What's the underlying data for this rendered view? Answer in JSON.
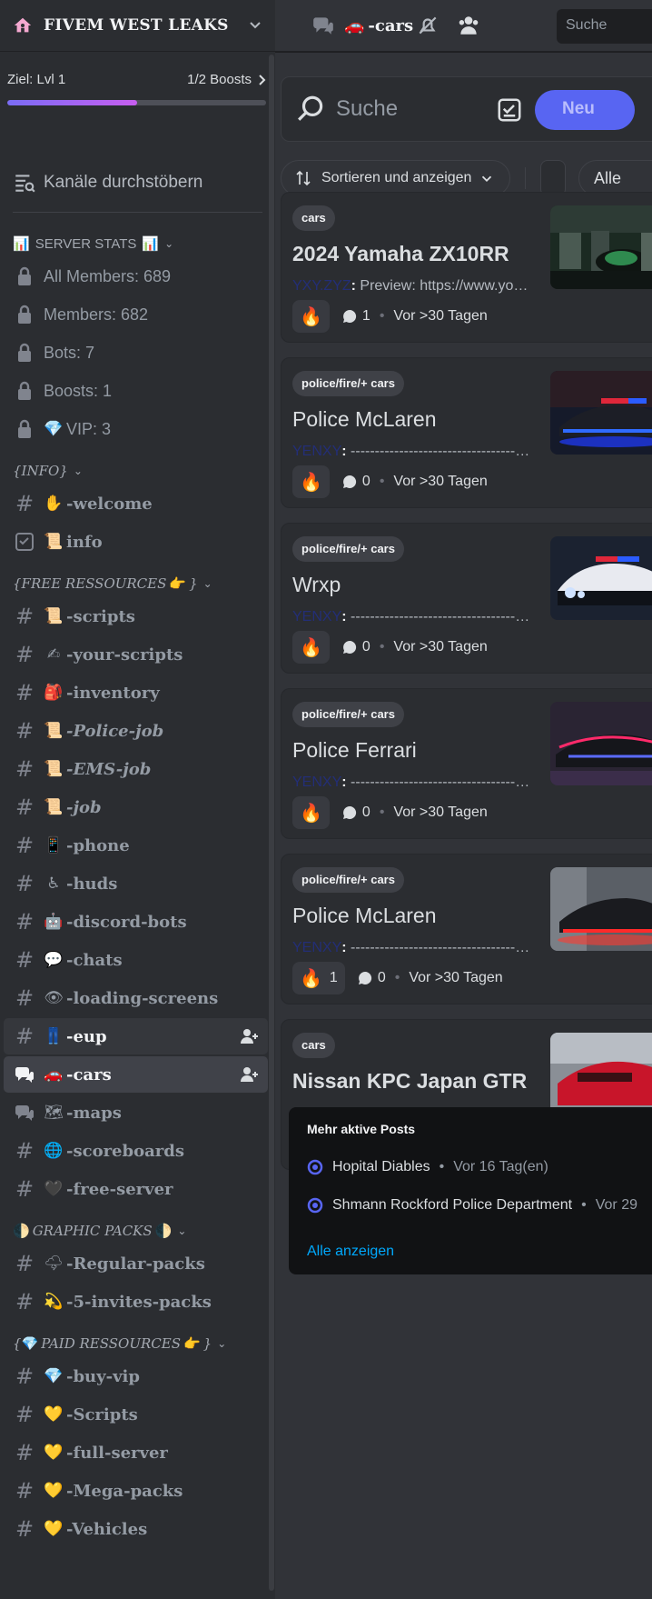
{
  "server": {
    "name": "FIVEM WEST LEAKS"
  },
  "boost": {
    "goal": "Ziel: Lvl 1",
    "progress": "1/2 Boosts",
    "fill_fraction": 0.5
  },
  "browse_label": "Kanäle durchstöbern",
  "categories": {
    "stats": "SERVER STATS",
    "stats_emoji": "📊",
    "info": "{INFO}",
    "free": "{FREE RESSOURCES",
    "free_tail": "}",
    "free_emoji": "👉",
    "graphic": "GRAPHIC PACKS",
    "graphic_emoji": "🌓",
    "paid": "{",
    "paid_emoji": "💎",
    "paid_name": "PAID RESSOURCES",
    "paid_tail": "}",
    "paid_emoji2": "👉"
  },
  "stats_channels": [
    {
      "label": "All Members: 689"
    },
    {
      "label": "Members: 682"
    },
    {
      "label": "Bots: 7"
    },
    {
      "label": "Boosts: 1"
    },
    {
      "emoji": "💎",
      "label": "VIP: 3"
    }
  ],
  "info_channels": [
    {
      "emoji": "✋",
      "label": "-welcome"
    },
    {
      "emoji": "📜",
      "label": "info"
    }
  ],
  "free_channels": [
    {
      "emoji": "📜",
      "label": "-scripts"
    },
    {
      "emoji": "✍",
      "label": "-your-scripts"
    },
    {
      "emoji": "🎒",
      "label": "-inventory"
    },
    {
      "emoji": "📜",
      "label": "-Police-job"
    },
    {
      "emoji": "📜",
      "label": "-EMS-job"
    },
    {
      "emoji": "📜",
      "label": "-job"
    },
    {
      "emoji": "📱",
      "label": "-phone"
    },
    {
      "emoji": "♿",
      "label": "-huds"
    },
    {
      "emoji": "🤖",
      "label": "-discord-bots"
    },
    {
      "emoji": "💬",
      "label": "-chats"
    },
    {
      "emoji": "👁",
      "label": "-loading-screens"
    },
    {
      "emoji": "👖",
      "label": "-eup"
    },
    {
      "emoji": "🚗",
      "label": "-cars"
    },
    {
      "emoji": "🗺",
      "label": "-maps"
    },
    {
      "emoji": "🌐",
      "label": "-scoreboards"
    },
    {
      "emoji": "🖤",
      "label": "-free-server"
    }
  ],
  "graphic_channels": [
    {
      "emoji": "🌩",
      "label": "-Regular-packs"
    },
    {
      "emoji": "💫",
      "label": "-5-invites-packs"
    }
  ],
  "paid_channels": [
    {
      "emoji": "💎",
      "label": "-buy-vip"
    },
    {
      "emoji": "💛",
      "label": "-Scripts"
    },
    {
      "emoji": "💛",
      "label": "-full-server"
    },
    {
      "emoji": "💛",
      "label": "-Mega-packs"
    },
    {
      "emoji": "💛",
      "label": "-Vehicles"
    }
  ],
  "header": {
    "channel_emoji": "🚗",
    "channel_name": "-cars",
    "search_placeholder": "Suche"
  },
  "forum": {
    "search_placeholder": "Suche",
    "new_button": "Neu",
    "sort_label": "Sortieren und anzeigen",
    "all_label": "Alle"
  },
  "posts": [
    {
      "tag": "cars",
      "title": "2024 Yamaha ZX10RR",
      "author": "YXY.ZYZ",
      "preview": "Preview: https://www.youtube.com/",
      "reaction": "🔥",
      "reaction_count": "",
      "comments": "1",
      "age": "Vor >30 Tagen"
    },
    {
      "tag": "police/fire/+ cars",
      "title": "Police McLaren",
      "author": "YENXY",
      "preview": "--------------------------------------",
      "reaction": "🔥",
      "reaction_count": "",
      "comments": "0",
      "age": "Vor >30 Tagen"
    },
    {
      "tag": "police/fire/+ cars",
      "title": "Wrxp",
      "author": "YENXY",
      "preview": "--------------------------------------",
      "reaction": "🔥",
      "reaction_count": "",
      "comments": "0",
      "age": "Vor >30 Tagen"
    },
    {
      "tag": "police/fire/+ cars",
      "title": "Police Ferrari",
      "author": "YENXY",
      "preview": "--------------------------------------",
      "reaction": "🔥",
      "reaction_count": "",
      "comments": "0",
      "age": "Vor >30 Tagen"
    },
    {
      "tag": "police/fire/+ cars",
      "title": "Police McLaren",
      "author": "YENXY",
      "preview": "--------------------------------------",
      "reaction": "🔥",
      "reaction_count": "1",
      "comments": "0",
      "age": "Vor >30 Tagen"
    },
    {
      "tag": "cars",
      "title": "Nissan KPC Japan GTR"
    }
  ],
  "active_posts": {
    "heading": "Mehr aktive Posts",
    "items": [
      {
        "title": "Hopital Diables",
        "age": "Vor 16 Tag(en)"
      },
      {
        "title": "Shmann Rockford Police Department",
        "age": "Vor 29"
      }
    ],
    "show_all": "Alle anzeigen"
  },
  "colors": {
    "accent": "#5865f2",
    "link": "#00a8fc",
    "sidebar": "#2b2d31",
    "main": "#313338"
  }
}
